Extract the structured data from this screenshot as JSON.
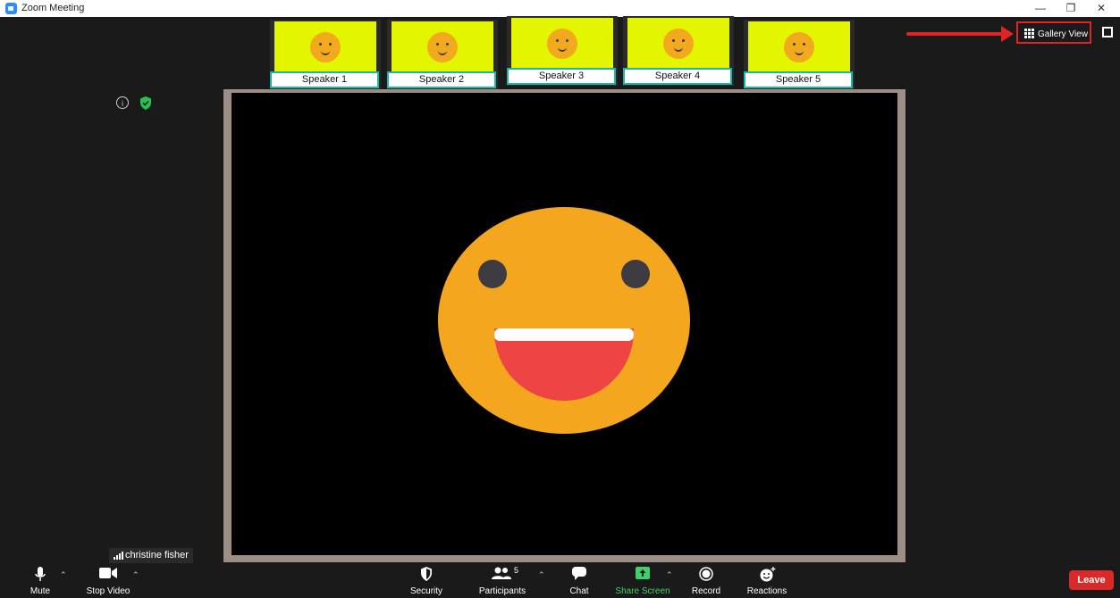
{
  "window": {
    "title": "Zoom Meeting",
    "controls": [
      "minimize-icon",
      "restore-icon",
      "close-icon"
    ]
  },
  "thumbnails": [
    {
      "label": "Speaker 1"
    },
    {
      "label": "Speaker 2"
    },
    {
      "label": "Speaker 3"
    },
    {
      "label": "Speaker 4"
    },
    {
      "label": "Speaker 5"
    }
  ],
  "view": {
    "gallery_label": "Gallery View"
  },
  "self": {
    "name": "christine fisher"
  },
  "toolbar": {
    "mute": "Mute",
    "stop_video": "Stop Video",
    "security": "Security",
    "participants": "Participants",
    "participant_count": "5",
    "chat": "Chat",
    "share_screen": "Share Screen",
    "record": "Record",
    "reactions": "Reactions",
    "leave": "Leave"
  },
  "colors": {
    "share_green": "#3dd16b",
    "leave_red": "#d92929",
    "highlight_red": "#e02424",
    "thumb_bg": "#e3f600",
    "label_border": "#1bb6a6",
    "emoji_face": "#f4a71e"
  }
}
